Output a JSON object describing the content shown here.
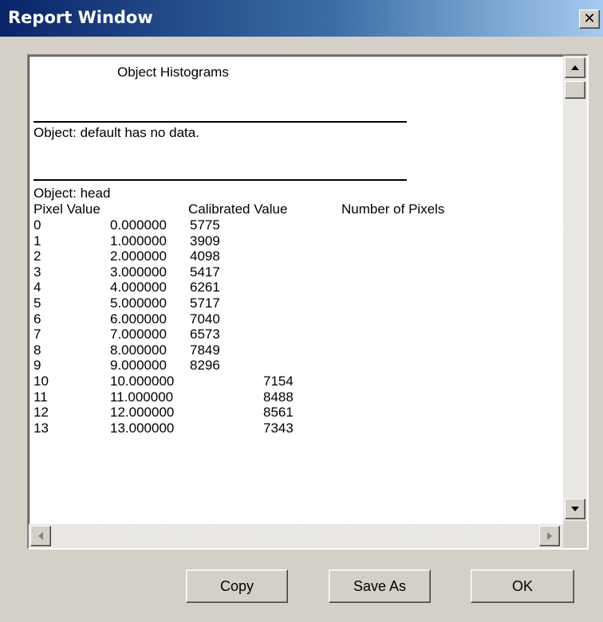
{
  "window": {
    "title": "Report Window",
    "close_glyph": "✕"
  },
  "report": {
    "heading": "Object Histograms",
    "no_data_line": "Object: default has no data.",
    "object_line": "Object: head",
    "columns": [
      "Pixel Value",
      "Calibrated Value",
      "Number of Pixels"
    ],
    "rows": [
      {
        "pixel": "0",
        "calibrated": "0.000000",
        "count": "5775"
      },
      {
        "pixel": "1",
        "calibrated": "1.000000",
        "count": "3909"
      },
      {
        "pixel": "2",
        "calibrated": "2.000000",
        "count": "4098"
      },
      {
        "pixel": "3",
        "calibrated": "3.000000",
        "count": "5417"
      },
      {
        "pixel": "4",
        "calibrated": "4.000000",
        "count": "6261"
      },
      {
        "pixel": "5",
        "calibrated": "5.000000",
        "count": "5717"
      },
      {
        "pixel": "6",
        "calibrated": "6.000000",
        "count": "7040"
      },
      {
        "pixel": "7",
        "calibrated": "7.000000",
        "count": "6573"
      },
      {
        "pixel": "8",
        "calibrated": "8.000000",
        "count": "7849"
      },
      {
        "pixel": "9",
        "calibrated": "9.000000",
        "count": "8296"
      },
      {
        "pixel": "10",
        "calibrated": "10.000000",
        "count": "7154"
      },
      {
        "pixel": "11",
        "calibrated": "11.000000",
        "count": "8488"
      },
      {
        "pixel": "12",
        "calibrated": "12.000000",
        "count": "8561"
      },
      {
        "pixel": "13",
        "calibrated": "13.000000",
        "count": "7343"
      }
    ]
  },
  "buttons": {
    "copy": "Copy",
    "save_as": "Save As",
    "ok": "OK"
  },
  "icons": {
    "close": "close-icon",
    "scroll_up": "arrow-up-icon",
    "scroll_down": "arrow-down-icon",
    "scroll_left": "arrow-left-icon",
    "scroll_right": "arrow-right-icon"
  }
}
